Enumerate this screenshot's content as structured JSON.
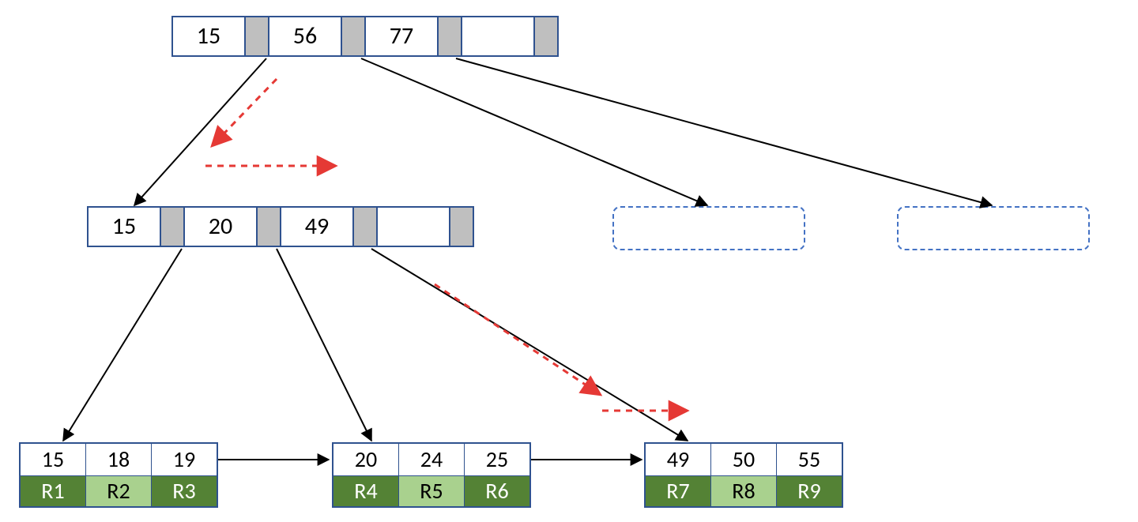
{
  "chart_data": {
    "type": "tree",
    "description": "B+ tree index diagram with root, one internal node, three leaves, and two placeholder subtrees.",
    "root": {
      "keys": [
        15,
        56,
        77,
        null
      ]
    },
    "internal": {
      "keys": [
        15,
        20,
        49,
        null
      ]
    },
    "leaves": [
      {
        "keys": [
          15,
          18,
          19
        ],
        "records": [
          "R1",
          "R2",
          "R3"
        ]
      },
      {
        "keys": [
          20,
          24,
          25
        ],
        "records": [
          "R4",
          "R5",
          "R6"
        ]
      },
      {
        "keys": [
          49,
          50,
          55
        ],
        "records": [
          "R7",
          "R8",
          "R9"
        ]
      }
    ]
  },
  "root": {
    "k0": "15",
    "k1": "56",
    "k2": "77",
    "k3": ""
  },
  "internal": {
    "k0": "15",
    "k1": "20",
    "k2": "49",
    "k3": ""
  },
  "leaf0": {
    "k0": "15",
    "k1": "18",
    "k2": "19",
    "r0": "R1",
    "r1": "R2",
    "r2": "R3"
  },
  "leaf1": {
    "k0": "20",
    "k1": "24",
    "k2": "25",
    "r0": "R4",
    "r1": "R5",
    "r2": "R6"
  },
  "leaf2": {
    "k0": "49",
    "k1": "50",
    "k2": "55",
    "r0": "R7",
    "r1": "R8",
    "r2": "R9"
  }
}
